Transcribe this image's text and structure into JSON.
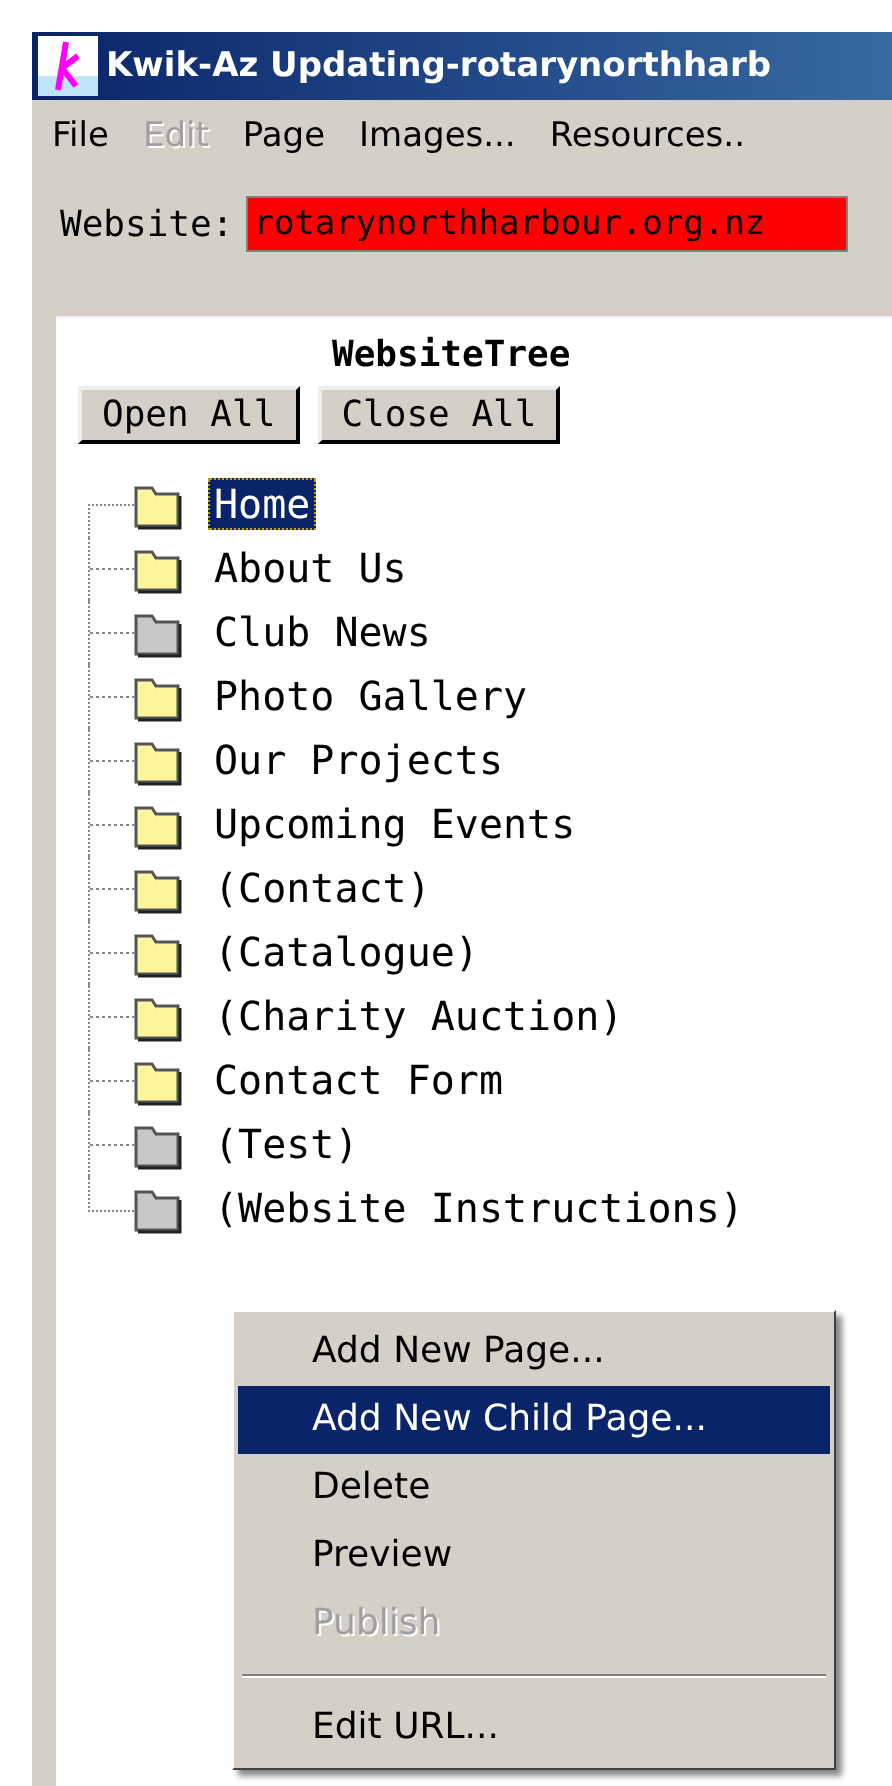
{
  "window": {
    "title": "Kwik-Az Updating-rotarynorthharb"
  },
  "menu": [
    {
      "label": "File",
      "disabled": false
    },
    {
      "label": "Edit",
      "disabled": true
    },
    {
      "label": "Page",
      "disabled": false
    },
    {
      "label": "Images...",
      "disabled": false
    },
    {
      "label": "Resources..",
      "disabled": false
    }
  ],
  "website": {
    "label": "Website:",
    "value": "rotarynorthharbour.org.nz"
  },
  "tree": {
    "title": "WebsiteTree",
    "buttons": [
      "Open All",
      "Close All"
    ],
    "items": [
      {
        "label": "Home",
        "color": "#fff49a",
        "selected": true
      },
      {
        "label": "About Us",
        "color": "#fff49a",
        "selected": false
      },
      {
        "label": "Club News",
        "color": "#c8c8c8",
        "selected": false
      },
      {
        "label": "Photo Gallery",
        "color": "#fff49a",
        "selected": false
      },
      {
        "label": "Our Projects",
        "color": "#fff49a",
        "selected": false
      },
      {
        "label": "Upcoming Events",
        "color": "#fff49a",
        "selected": false
      },
      {
        "label": "(Contact)",
        "color": "#fff49a",
        "selected": false
      },
      {
        "label": "(Catalogue)",
        "color": "#fff49a",
        "selected": false
      },
      {
        "label": "(Charity Auction)",
        "color": "#fff49a",
        "selected": false
      },
      {
        "label": "Contact Form",
        "color": "#fff49a",
        "selected": false
      },
      {
        "label": "(Test)",
        "color": "#c8c8c8",
        "selected": false
      },
      {
        "label": "(Website Instructions)",
        "color": "#c8c8c8",
        "selected": false
      }
    ]
  },
  "context_menu": [
    {
      "kind": "item",
      "label": "Add New Page...",
      "selected": false,
      "disabled": false
    },
    {
      "kind": "item",
      "label": "Add New Child Page...",
      "selected": true,
      "disabled": false
    },
    {
      "kind": "item",
      "label": "Delete",
      "selected": false,
      "disabled": false
    },
    {
      "kind": "item",
      "label": "Preview",
      "selected": false,
      "disabled": false
    },
    {
      "kind": "item",
      "label": "Publish",
      "selected": false,
      "disabled": true
    },
    {
      "kind": "separator"
    },
    {
      "kind": "item",
      "label": "Edit URL...",
      "selected": false,
      "disabled": false
    }
  ]
}
